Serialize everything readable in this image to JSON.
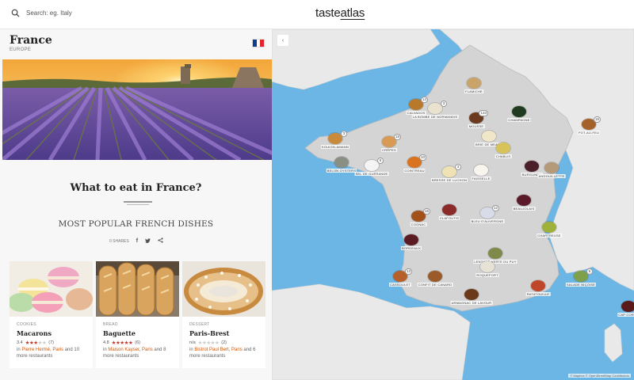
{
  "header": {
    "search_placeholder": "Search: eg. Italy",
    "logo_main": "taste",
    "logo_accent": "atlas"
  },
  "region": {
    "title": "France",
    "continent": "EUROPE",
    "flag_colors": [
      "#0b3d91",
      "#ffffff",
      "#e1262c"
    ]
  },
  "section": {
    "heading": "What to eat in France?",
    "subheading": "MOST POPULAR FRENCH DISHES",
    "shares": "0 SHARES",
    "share_icons": [
      "facebook-icon",
      "twitter-icon",
      "share-icon"
    ]
  },
  "dishes": [
    {
      "category": "COOKIES",
      "name": "Macarons",
      "score": "3.4",
      "stars_on": 3,
      "reviews": "(7)",
      "where_prefix": "in ",
      "place": "Pierre Hermé",
      "sep": ", ",
      "city": "Paris",
      "suffix": " and 10 more restaurants"
    },
    {
      "category": "BREAD",
      "name": "Baguette",
      "score": "4.8",
      "stars_on": 5,
      "reviews": "(6)",
      "where_prefix": "in ",
      "place": "Maison Kayser",
      "sep": ", ",
      "city": "Paris",
      "suffix": " and 8 more restaurants"
    },
    {
      "category": "DESSERT",
      "name": "Paris-Brest",
      "score": "n/a",
      "stars_on": 0,
      "reviews": "(2)",
      "where_prefix": "in ",
      "place": "Bistrot Paul Bert",
      "sep": ", ",
      "city": "Paris",
      "suffix": " and 6 more restaurants"
    }
  ],
  "map": {
    "collapse_icon": "‹",
    "attribution": "© Mapbox © OpenStreetMap Contributors",
    "pins": [
      {
        "label": "FLAMICHE",
        "count": "",
        "color": "#c9a36a"
      },
      {
        "label": "CALVADOS",
        "count": "14",
        "color": "#b87a2a"
      },
      {
        "label": "LA BOMBE DE NORMANDIE",
        "count": "3",
        "color": "#e9e2cf"
      },
      {
        "label": "MOUSSE",
        "count": "133",
        "color": "#6b3a1f"
      },
      {
        "label": "CHAMPAGNE",
        "count": "",
        "color": "#1f3a1f"
      },
      {
        "label": "BRIE DE MEAUX",
        "count": "",
        "color": "#f0e7c8"
      },
      {
        "label": "POT-AU-FEU",
        "count": "16",
        "color": "#a4622a"
      },
      {
        "label": "KOUIGN-AMANN",
        "count": "3",
        "color": "#c98a3c"
      },
      {
        "label": "CRÊPES",
        "count": "18",
        "color": "#d99b53"
      },
      {
        "label": "BELON OYSTERS",
        "count": "",
        "color": "#8a8f84"
      },
      {
        "label": "COINTREAU",
        "count": "10",
        "color": "#d9731f"
      },
      {
        "label": "CHABLIS",
        "count": "",
        "color": "#d8c35a"
      },
      {
        "label": "SEL DE GUÉRANDE",
        "count": "6",
        "color": "#f4f4f4"
      },
      {
        "label": "BRESSE DE LUCHON",
        "count": "3",
        "color": "#efe3b6"
      },
      {
        "label": "FAISSELLE",
        "count": "",
        "color": "#f7f5ee"
      },
      {
        "label": "BURGUNDY",
        "count": "",
        "color": "#4a1f2a"
      },
      {
        "label": "ANDOUILLETTE",
        "count": "",
        "color": "#b59a7a"
      },
      {
        "label": "COGNAC",
        "count": "15",
        "color": "#a3511b"
      },
      {
        "label": "CLAFOUTIS",
        "count": "",
        "color": "#8c2a2a"
      },
      {
        "label": "BLEU D'AUVERGNE",
        "count": "12",
        "color": "#d8dce8"
      },
      {
        "label": "BEAUJOLAIS",
        "count": "",
        "color": "#5a1a2a"
      },
      {
        "label": "CHARTREUSE",
        "count": "",
        "color": "#9fb13a"
      },
      {
        "label": "BORDEAUX",
        "count": "",
        "color": "#5a1c22"
      },
      {
        "label": "LENTILLE VERTE DU PUY",
        "count": "",
        "color": "#7f8a4a"
      },
      {
        "label": "ROQUEFORT",
        "count": "",
        "color": "#e6e3d6"
      },
      {
        "label": "CASSOULET",
        "count": "13",
        "color": "#b5602a"
      },
      {
        "label": "CONFIT DE CANARD",
        "count": "",
        "color": "#9a5a2a"
      },
      {
        "label": "SALADE NIÇOISE",
        "count": "6",
        "color": "#7ea04a"
      },
      {
        "label": "RATATOUILLE",
        "count": "",
        "color": "#c0462a"
      },
      {
        "label": "ARMAGNAC DE LAVOUR",
        "count": "",
        "color": "#6a3a1a"
      },
      {
        "label": "CAP CORSE",
        "count": "",
        "color": "#5a1a1a"
      }
    ]
  }
}
